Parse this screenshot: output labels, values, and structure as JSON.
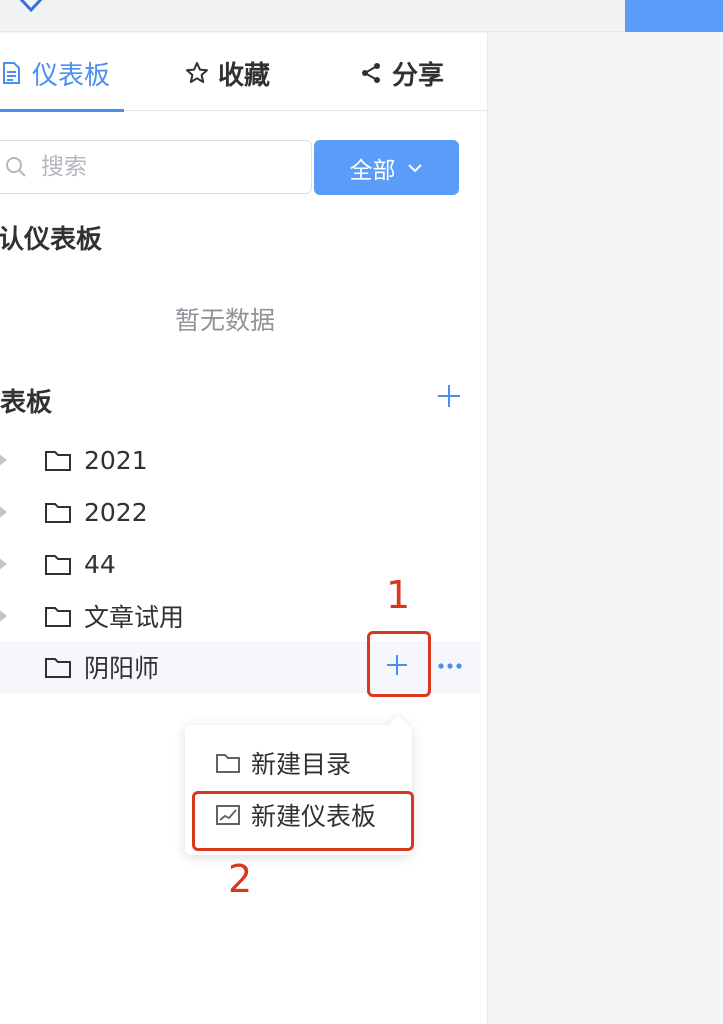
{
  "colors": {
    "accent": "#4a8ff0",
    "button": "#5a9cf8",
    "annotation": "#d9381e"
  },
  "tabs": [
    {
      "label": "仪表板",
      "icon": "document-icon",
      "active": true
    },
    {
      "label": "收藏",
      "icon": "star-icon",
      "active": false
    },
    {
      "label": "分享",
      "icon": "share-icon",
      "active": false
    }
  ],
  "search": {
    "placeholder": "搜索",
    "value": ""
  },
  "filter": {
    "label": "全部"
  },
  "default_section": {
    "title": "默认仪表板",
    "empty_text": "暂无数据"
  },
  "dashboard_section": {
    "title": "仪表板"
  },
  "tree": [
    {
      "label": "2021"
    },
    {
      "label": "2022"
    },
    {
      "label": "44"
    },
    {
      "label": "文章试用"
    },
    {
      "label": "阴阳师"
    }
  ],
  "popover": {
    "items": [
      {
        "label": "新建目录",
        "icon": "folder-icon"
      },
      {
        "label": "新建仪表板",
        "icon": "dashboard-icon"
      }
    ]
  },
  "annotations": {
    "step1": "1",
    "step2": "2"
  }
}
